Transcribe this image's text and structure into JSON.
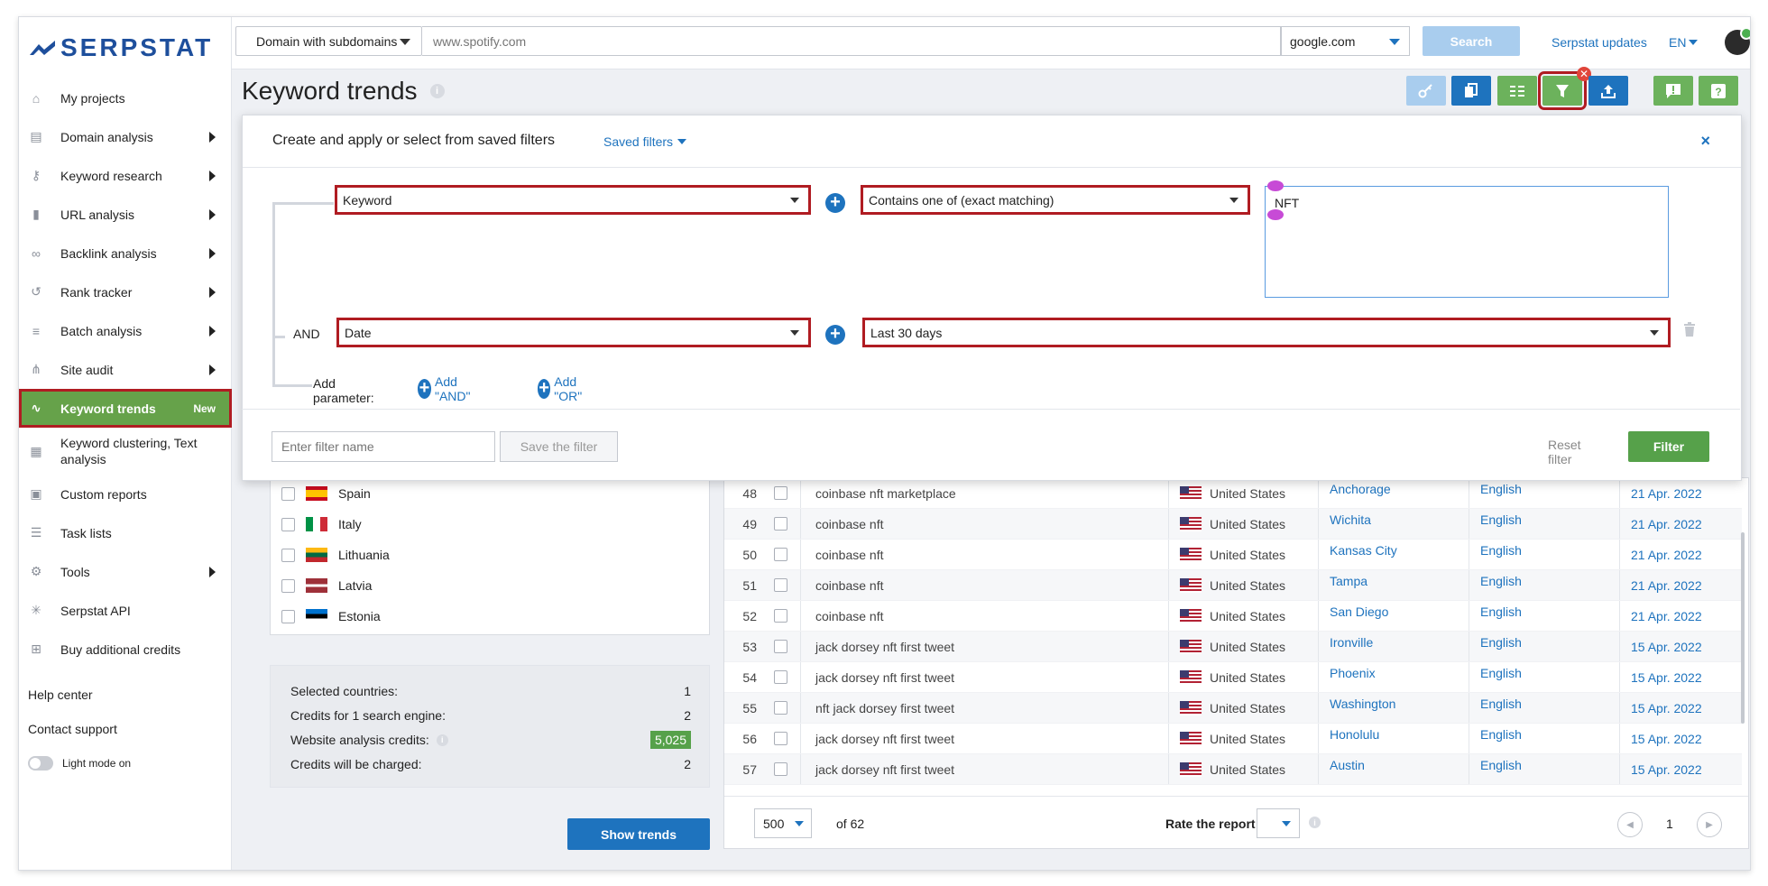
{
  "brand": {
    "name": "SERPSTAT"
  },
  "topbar": {
    "search_type": "Domain with subdomains",
    "search_placeholder": "www.spotify.com",
    "engine": "google.com",
    "search_label": "Search",
    "updates_label": "Serpstat updates",
    "language": "EN"
  },
  "sidebar": {
    "items": [
      {
        "label": "My projects",
        "icon": "home-icon"
      },
      {
        "label": "Domain analysis",
        "icon": "chart-bars-icon"
      },
      {
        "label": "Keyword research",
        "icon": "key-icon"
      },
      {
        "label": "URL analysis",
        "icon": "bar-chart-icon"
      },
      {
        "label": "Backlink analysis",
        "icon": "link-icon"
      },
      {
        "label": "Rank tracker",
        "icon": "history-icon"
      },
      {
        "label": "Batch analysis",
        "icon": "database-icon"
      },
      {
        "label": "Site audit",
        "icon": "sitemap-icon"
      },
      {
        "label": "Keyword trends",
        "icon": "trend-icon",
        "badge": "New"
      },
      {
        "label": "Keyword clustering, Text analysis",
        "icon": "cluster-icon"
      },
      {
        "label": "Custom reports",
        "icon": "report-icon"
      },
      {
        "label": "Task lists",
        "icon": "list-icon"
      },
      {
        "label": "Tools",
        "icon": "gear-icon"
      },
      {
        "label": "Serpstat API",
        "icon": "api-icon"
      },
      {
        "label": "Buy additional credits",
        "icon": "credits-icon"
      }
    ],
    "help_center": "Help center",
    "contact_support": "Contact support",
    "light_mode": "Light mode on"
  },
  "page": {
    "title": "Keyword trends",
    "info": "i"
  },
  "filter_panel": {
    "title": "Create and apply or select from saved filters",
    "saved_filters": "Saved filters",
    "close": "×",
    "row1_param": "Keyword",
    "row1_condition": "Contains one of (exact matching)",
    "row1_value": "NFT",
    "and_label": "AND",
    "row2_param": "Date",
    "row2_value": "Last 30 days",
    "add_parameter": "Add parameter:",
    "add_and": "Add \"AND\"",
    "add_or": "Add \"OR\"",
    "filter_name_placeholder": "Enter filter name",
    "save_filter": "Save the filter",
    "reset_filter": "Reset filter",
    "filter_btn": "Filter"
  },
  "countries": [
    {
      "name": "Spain",
      "flag": "spain-flag"
    },
    {
      "name": "Italy",
      "flag": "italy-flag"
    },
    {
      "name": "Lithuania",
      "flag": "lithuania-flag"
    },
    {
      "name": "Latvia",
      "flag": "latvia-flag"
    },
    {
      "name": "Estonia",
      "flag": "estonia-flag"
    }
  ],
  "credits": {
    "selected_label": "Selected countries:",
    "selected_value": "1",
    "engine_label": "Credits for 1 search engine:",
    "engine_value": "2",
    "website_label": "Website analysis credits:",
    "website_value": "5,025",
    "charged_label": "Credits will be charged:",
    "charged_value": "2"
  },
  "show_trends": "Show trends",
  "results": {
    "rows": [
      {
        "num": "48",
        "keyword": "coinbase nft marketplace",
        "country": "United States",
        "city": "Anchorage",
        "lang": "English",
        "date": "21 Apr. 2022"
      },
      {
        "num": "49",
        "keyword": "coinbase nft",
        "country": "United States",
        "city": "Wichita",
        "lang": "English",
        "date": "21 Apr. 2022"
      },
      {
        "num": "50",
        "keyword": "coinbase nft",
        "country": "United States",
        "city": "Kansas City",
        "lang": "English",
        "date": "21 Apr. 2022"
      },
      {
        "num": "51",
        "keyword": "coinbase nft",
        "country": "United States",
        "city": "Tampa",
        "lang": "English",
        "date": "21 Apr. 2022"
      },
      {
        "num": "52",
        "keyword": "coinbase nft",
        "country": "United States",
        "city": "San Diego",
        "lang": "English",
        "date": "21 Apr. 2022"
      },
      {
        "num": "53",
        "keyword": "jack dorsey nft first tweet",
        "country": "United States",
        "city": "Ironville",
        "lang": "English",
        "date": "15 Apr. 2022"
      },
      {
        "num": "54",
        "keyword": "jack dorsey nft first tweet",
        "country": "United States",
        "city": "Phoenix",
        "lang": "English",
        "date": "15 Apr. 2022"
      },
      {
        "num": "55",
        "keyword": "nft jack dorsey first tweet",
        "country": "United States",
        "city": "Washington",
        "lang": "English",
        "date": "15 Apr. 2022"
      },
      {
        "num": "56",
        "keyword": "jack dorsey nft first tweet",
        "country": "United States",
        "city": "Honolulu",
        "lang": "English",
        "date": "15 Apr. 2022"
      },
      {
        "num": "57",
        "keyword": "jack dorsey nft first tweet",
        "country": "United States",
        "city": "Austin",
        "lang": "English",
        "date": "15 Apr. 2022"
      }
    ],
    "per_page": "500",
    "of_pages": "of 62",
    "rate_label": "Rate the report",
    "current_page": "1"
  },
  "colors": {
    "accent_green": "#56a14a",
    "accent_blue": "#1e73be",
    "highlight_red": "#b01c22"
  }
}
